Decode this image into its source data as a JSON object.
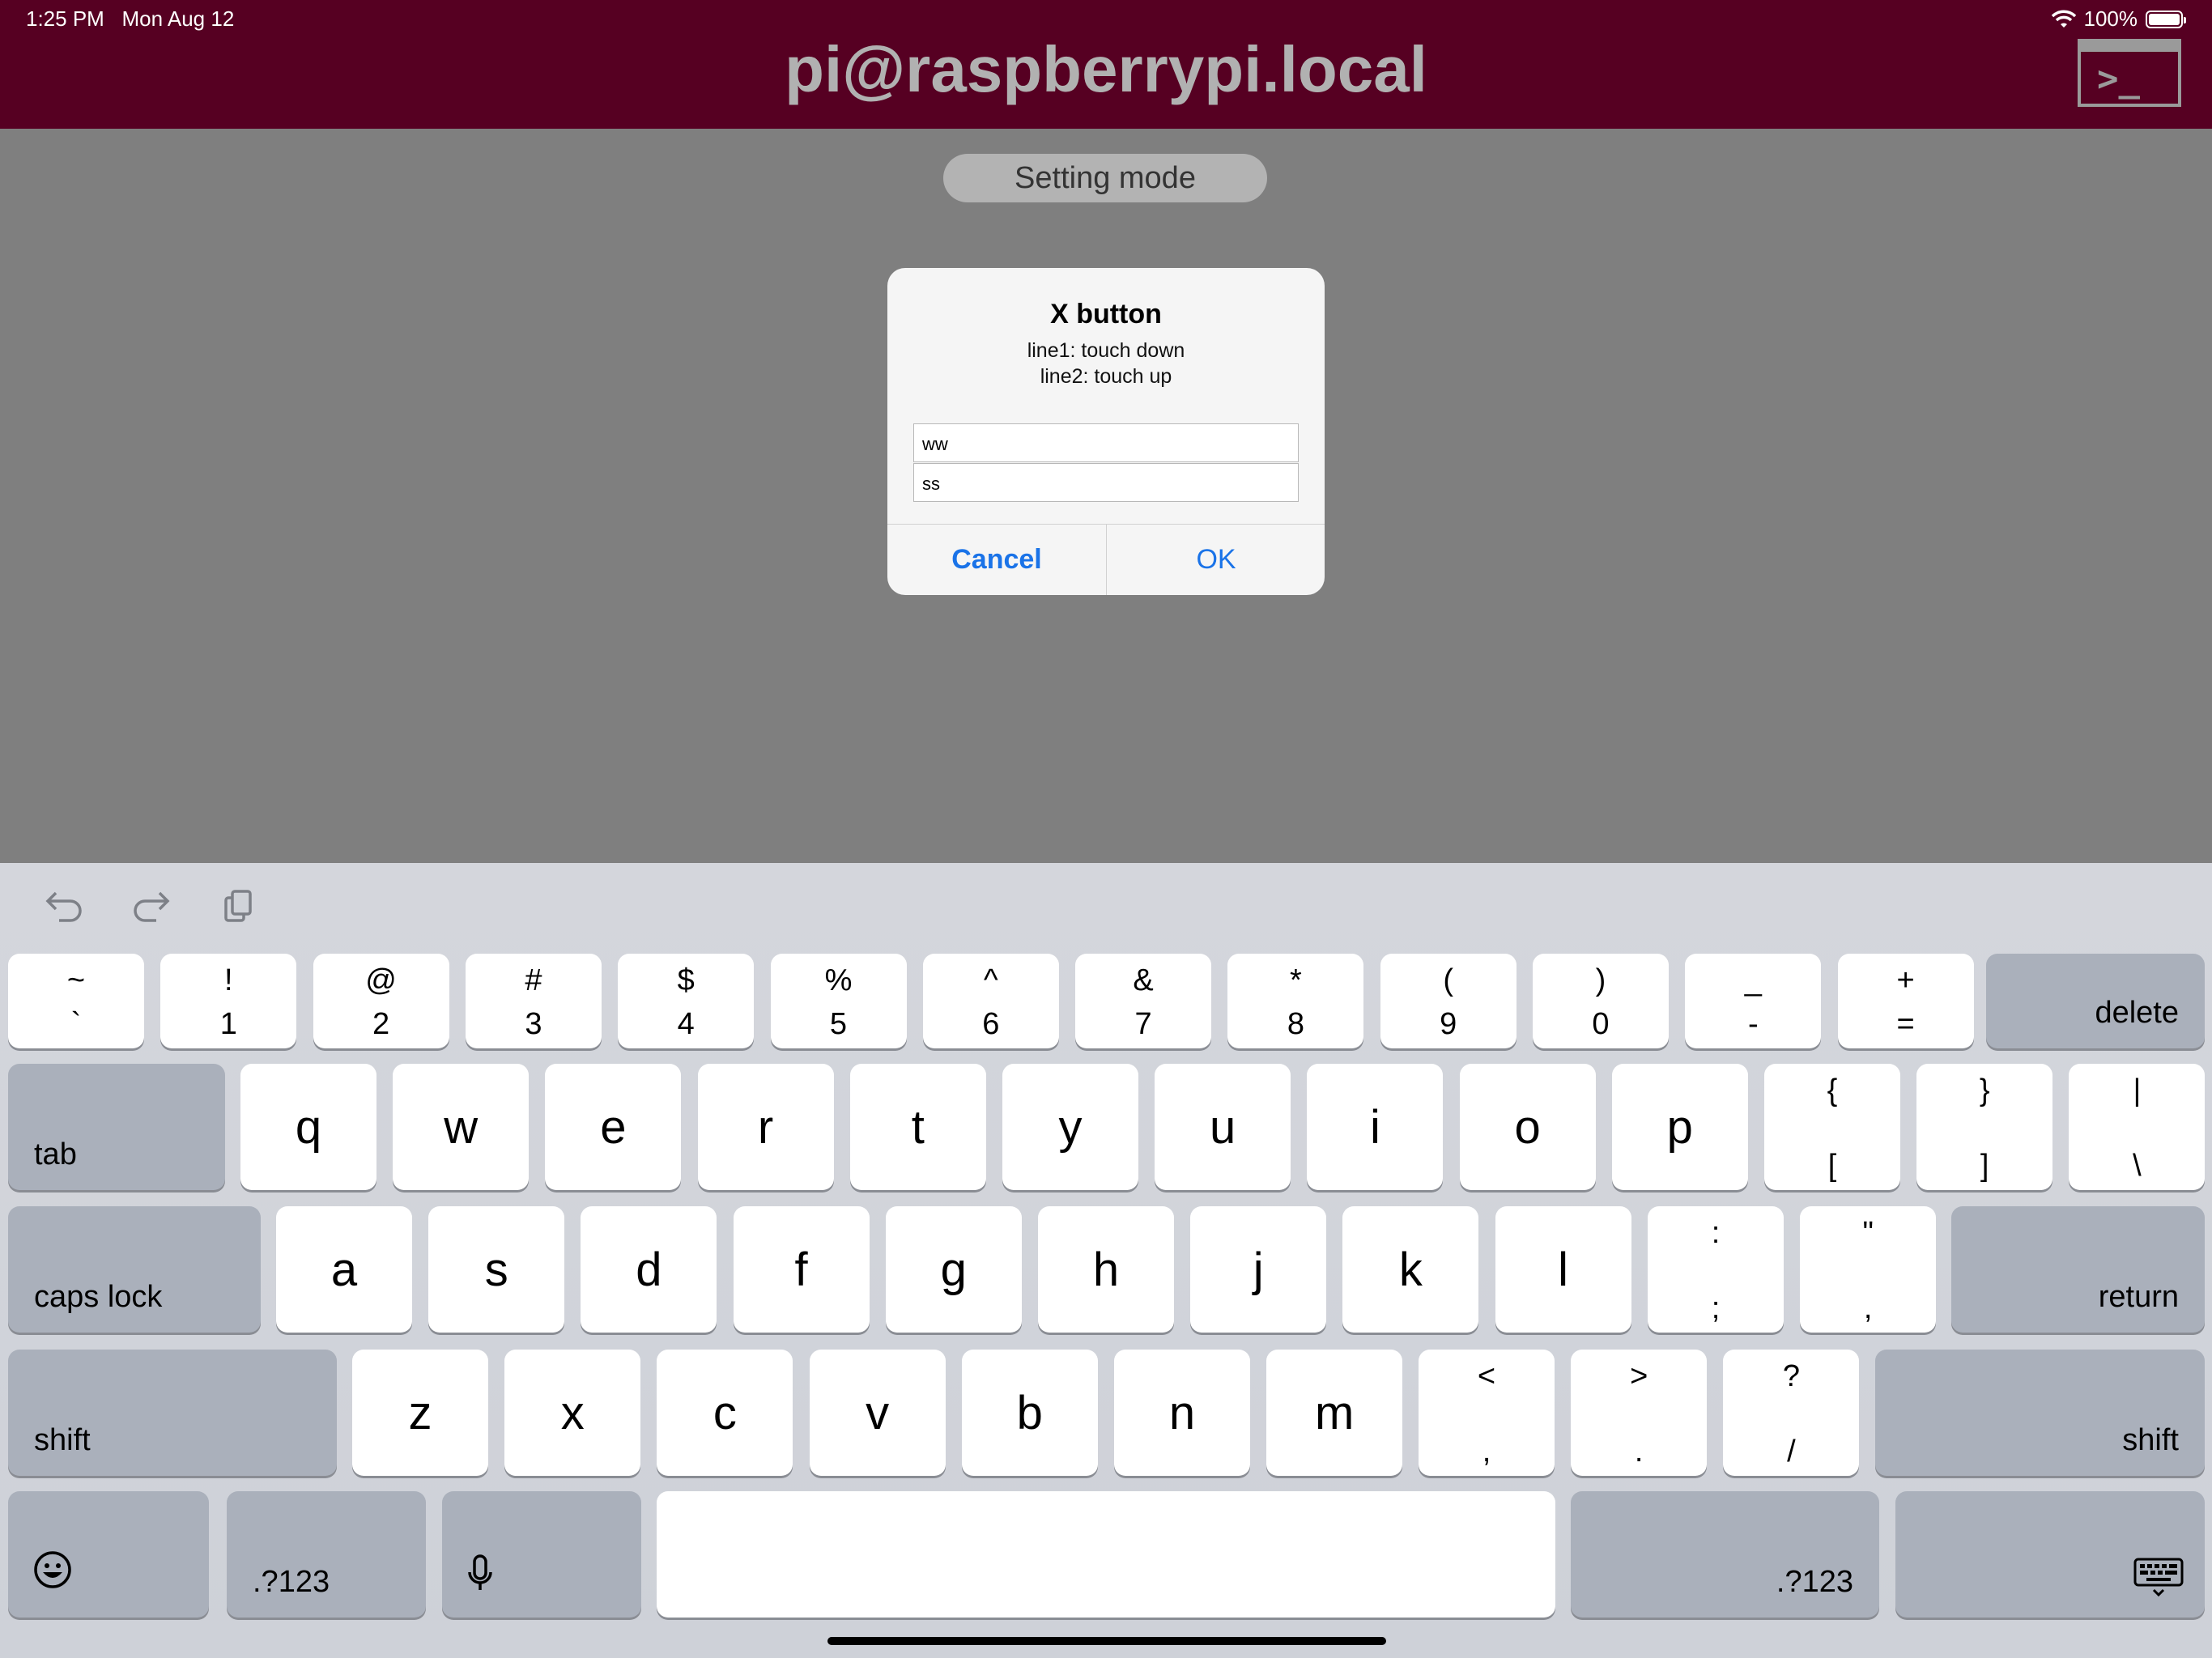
{
  "status_bar": {
    "time": "1:25 PM",
    "date": "Mon Aug 12",
    "battery": "100%"
  },
  "header": {
    "title": "pi@raspberrypi.local",
    "terminal_prompt": ">_"
  },
  "mode_pill": "Setting mode",
  "dialog": {
    "title": "X button",
    "line1": "line1: touch down",
    "line2": "line2: touch up",
    "field1_value": "ww",
    "field2_value": "ss",
    "cancel_label": "Cancel",
    "ok_label": "OK"
  },
  "toolbar": {
    "undo_icon": "undo-icon",
    "redo_icon": "redo-icon",
    "paste_icon": "paste-icon"
  },
  "keyboard": {
    "row1": [
      {
        "top": "~",
        "bot": "`"
      },
      {
        "top": "!",
        "bot": "1"
      },
      {
        "top": "@",
        "bot": "2"
      },
      {
        "top": "#",
        "bot": "3"
      },
      {
        "top": "$",
        "bot": "4"
      },
      {
        "top": "%",
        "bot": "5"
      },
      {
        "top": "^",
        "bot": "6"
      },
      {
        "top": "&",
        "bot": "7"
      },
      {
        "top": "*",
        "bot": "8"
      },
      {
        "top": "(",
        "bot": "9"
      },
      {
        "top": ")",
        "bot": "0"
      },
      {
        "top": "_",
        "bot": "-"
      },
      {
        "top": "+",
        "bot": "="
      }
    ],
    "delete_label": "delete",
    "tab_label": "tab",
    "row2": [
      "q",
      "w",
      "e",
      "r",
      "t",
      "y",
      "u",
      "i",
      "o",
      "p"
    ],
    "row2_sym": [
      {
        "top": "{",
        "bot": "["
      },
      {
        "top": "}",
        "bot": "]"
      },
      {
        "top": "|",
        "bot": "\\"
      }
    ],
    "caps_label": "caps lock",
    "row3": [
      "a",
      "s",
      "d",
      "f",
      "g",
      "h",
      "j",
      "k",
      "l"
    ],
    "row3_sym": [
      {
        "top": ":",
        "bot": ";"
      },
      {
        "top": "\"",
        "bot": ","
      }
    ],
    "return_label": "return",
    "shift_label": "shift",
    "row4": [
      "z",
      "x",
      "c",
      "v",
      "b",
      "n",
      "m"
    ],
    "row4_sym": [
      {
        "top": "<",
        "bot": ","
      },
      {
        "top": ">",
        "bot": "."
      },
      {
        "top": "?",
        "bot": "/"
      }
    ],
    "numbers_label": ".?123",
    "emoji_icon": "emoji-icon",
    "mic_icon": "microphone-icon",
    "dismiss_icon": "keyboard-dismiss-icon"
  }
}
